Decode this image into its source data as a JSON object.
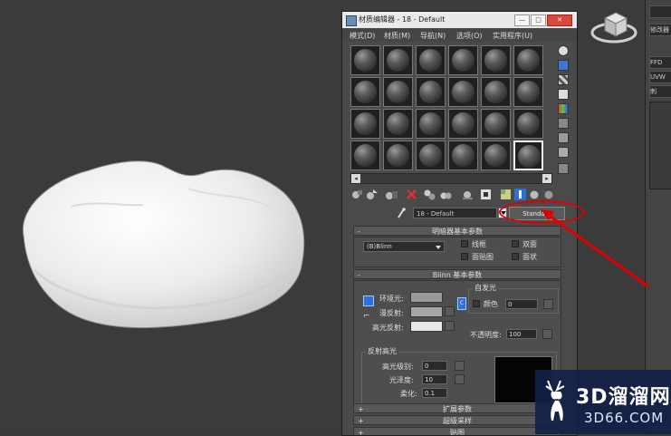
{
  "window": {
    "title": "材质编辑器 - 18 - Default",
    "controls": {
      "minimize": "—",
      "maximize": "□",
      "close": "✕"
    }
  },
  "menu": [
    "模式(D)",
    "材质(M)",
    "导航(N)",
    "选项(O)",
    "实用程序(U)"
  ],
  "slots": {
    "rows": 4,
    "cols": 6,
    "active_index": 23
  },
  "material_name": "18 - Default",
  "material_type": "Standard",
  "shader_basic": {
    "header": "明暗器基本参数",
    "shader": "(B)Blinn",
    "options": [
      "线框",
      "双面",
      "面贴图",
      "面状"
    ]
  },
  "blinn_basic": {
    "header": "Blinn 基本参数",
    "self_illum_title": "自发光",
    "ambient_label": "环境光:",
    "diffuse_label": "漫反射:",
    "specular_label": "高光反射:",
    "color_label": "颜色",
    "color_value": "0",
    "opacity_label": "不透明度:",
    "opacity_value": "100",
    "lock_button": "C",
    "colors": {
      "ambient": "#9a9a9a",
      "diffuse": "#a6a6a6",
      "specular": "#e6e6e6"
    }
  },
  "highlights": {
    "group_title": "反射高光",
    "level_label": "高光级别:",
    "level_value": "0",
    "gloss_label": "光泽度:",
    "gloss_value": "10",
    "soften_label": "柔化:",
    "soften_value": "0.1"
  },
  "more_rollouts": [
    "扩展参数",
    "超级采样",
    "贴图"
  ],
  "right_panel": [
    "修改器",
    "FFD",
    "UVW",
    "刺"
  ],
  "watermark": {
    "brand": "3D溜溜网",
    "url": "3D66.COM"
  },
  "accent_colors": {
    "annotation_red": "#e00000",
    "selection_blue": "#2e6fd8"
  }
}
